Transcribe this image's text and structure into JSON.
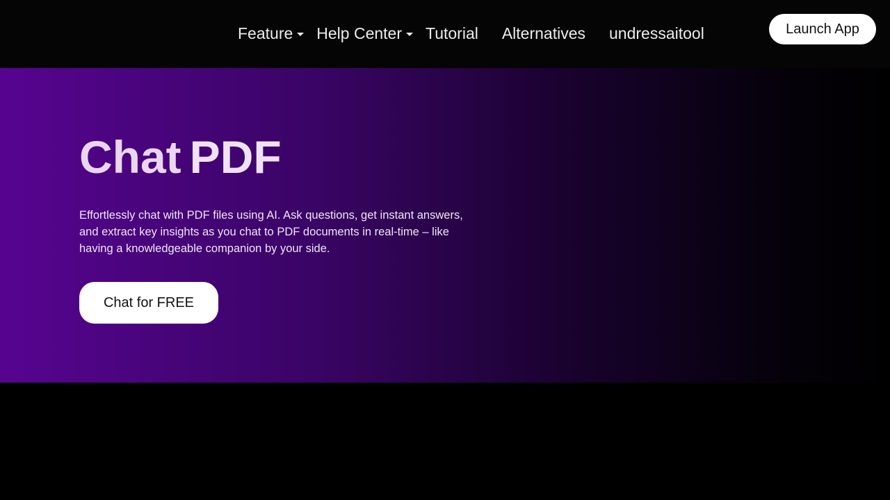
{
  "nav": {
    "items": [
      {
        "label": "Feature",
        "dropdown": true
      },
      {
        "label": "Help Center",
        "dropdown": true
      },
      {
        "label": "Tutorial",
        "dropdown": false
      },
      {
        "label": "Alternatives",
        "dropdown": false
      },
      {
        "label": "undressaitool",
        "dropdown": false
      }
    ],
    "launch_label": "Launch App"
  },
  "hero": {
    "title_word1": "Chat",
    "title_word2": "PDF",
    "description": "Effortlessly chat with PDF files using AI. Ask questions, get instant answers, and extract key insights as you chat to PDF documents in real-time – like having a knowledgeable companion by your side.",
    "cta_label": "Chat for FREE"
  },
  "colors": {
    "accent_purple": "#560490",
    "nav_background": "#050505",
    "button_background": "#ffffff"
  }
}
